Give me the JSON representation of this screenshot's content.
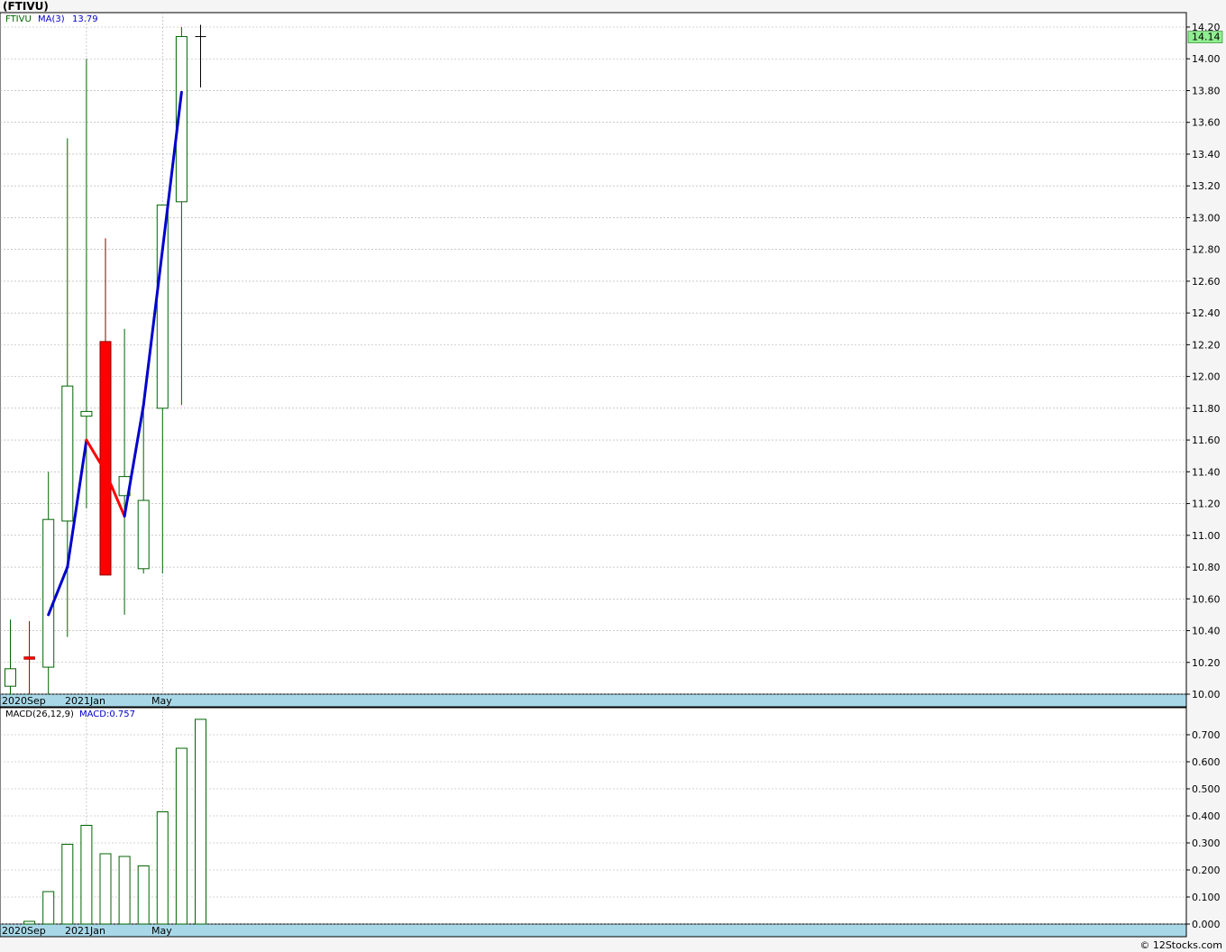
{
  "header": {
    "title": "(FTIVU)"
  },
  "credit": "© 12Stocks.com",
  "chart_data": [
    {
      "type": "candlestick",
      "symbol": "FTIVU",
      "ma_label": "MA(3)",
      "ma_value": "13.79",
      "last_price_label": "14.14",
      "ylim": [
        10.0,
        14.2
      ],
      "yticks": [
        "10.00",
        "10.20",
        "10.40",
        "10.60",
        "10.80",
        "11.00",
        "11.20",
        "11.40",
        "11.60",
        "11.80",
        "12.00",
        "12.20",
        "12.40",
        "12.60",
        "12.80",
        "13.00",
        "13.20",
        "13.40",
        "13.60",
        "13.80",
        "14.00",
        "14.20"
      ],
      "xtick_labels": [
        "2020Sep",
        "2021Jan",
        "May"
      ],
      "grid": true,
      "candles": [
        {
          "open": 10.05,
          "high": 10.47,
          "low": 10.0,
          "close": 10.16
        },
        {
          "open": 10.23,
          "high": 10.46,
          "low": 10.0,
          "close": 10.23
        },
        {
          "open": 10.17,
          "high": 11.4,
          "low": 10.0,
          "close": 11.1
        },
        {
          "open": 11.09,
          "high": 13.5,
          "low": 10.36,
          "close": 11.94
        },
        {
          "open": 11.75,
          "high": 14.0,
          "low": 11.17,
          "close": 11.78
        },
        {
          "open": 12.22,
          "high": 12.87,
          "low": 10.75,
          "close": 10.75
        },
        {
          "open": 11.25,
          "high": 12.3,
          "low": 10.5,
          "close": 11.37
        },
        {
          "open": 10.79,
          "high": 11.86,
          "low": 10.76,
          "close": 11.22
        },
        {
          "open": 11.8,
          "high": 13.08,
          "low": 10.76,
          "close": 13.08
        },
        {
          "open": 13.1,
          "high": 14.2,
          "low": 11.82,
          "close": 14.14
        },
        {
          "open": 14.14,
          "high": 14.18,
          "low": 13.82,
          "close": 14.14
        }
      ],
      "ma_values": [
        null,
        null,
        10.5,
        10.8,
        11.6,
        11.4,
        11.12,
        11.82,
        12.8,
        13.79
      ]
    },
    {
      "type": "bar",
      "label": "MACD(26,12,9)",
      "value_label": "MACD:0.757",
      "ylim": [
        0.0,
        0.75
      ],
      "yticks": [
        "0.000",
        "0.100",
        "0.200",
        "0.300",
        "0.400",
        "0.500",
        "0.600",
        "0.700"
      ],
      "xtick_labels": [
        "2020Sep",
        "2021Jan",
        "May"
      ],
      "values": [
        0.0,
        0.01,
        0.12,
        0.295,
        0.365,
        0.26,
        0.25,
        0.215,
        0.415,
        0.65,
        0.757
      ]
    }
  ]
}
